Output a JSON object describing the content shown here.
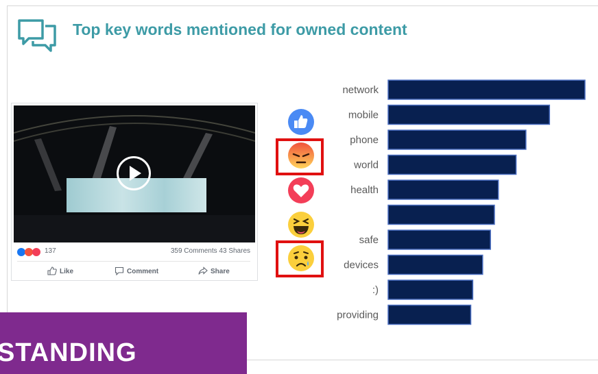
{
  "header": {
    "title": "Top key words mentioned for owned content",
    "icon": "chat-bubbles-icon"
  },
  "post": {
    "reaction_count": "137",
    "comments_shares": "359 Comments  43 Shares",
    "actions": {
      "like": "Like",
      "comment": "Comment",
      "share": "Share"
    }
  },
  "reactions": [
    "like-reaction-icon",
    "angry-reaction-icon",
    "love-reaction-icon",
    "haha-reaction-icon",
    "sad-reaction-icon"
  ],
  "highlighted_reactions": [
    "angry-reaction-icon",
    "sad-reaction-icon"
  ],
  "colors": {
    "bar": "#082050",
    "bar_border": "#4b6fc2",
    "title": "#3d9ba6",
    "banner": "#7f2a8e",
    "highlight": "#e01010"
  },
  "banner": {
    "text": "STANDING"
  },
  "chart_data": {
    "type": "bar",
    "orientation": "horizontal",
    "categories": [
      "network",
      "mobile",
      "phone",
      "world",
      "health",
      "",
      "safe",
      "devices",
      ":)",
      "providing"
    ],
    "values": [
      100,
      82,
      70,
      65,
      56,
      54,
      52,
      48,
      43,
      42
    ],
    "title": "Top key words mentioned for owned content",
    "xlim": [
      0,
      100
    ],
    "grid": false,
    "legend": "none"
  }
}
